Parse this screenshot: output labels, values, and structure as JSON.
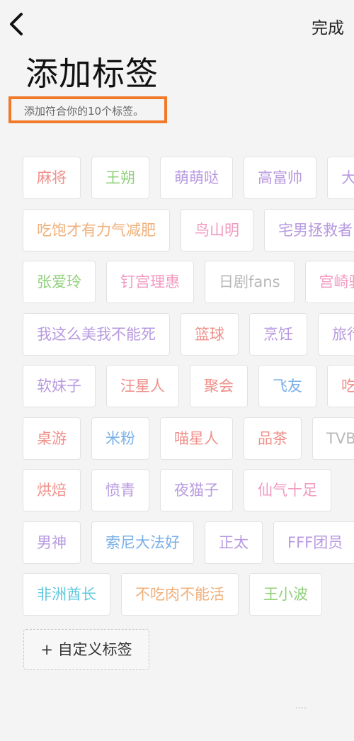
{
  "header": {
    "done_label": "完成"
  },
  "page": {
    "title": "添加标签",
    "subtitle": "添加符合你的10个标签。"
  },
  "tag_rows": [
    [
      {
        "label": "麻将",
        "color": "#f0908a"
      },
      {
        "label": "王朔",
        "color": "#8fd07a"
      },
      {
        "label": "萌萌哒",
        "color": "#b89ae0"
      },
      {
        "label": "高富帅",
        "color": "#b89ae0"
      },
      {
        "label": "大长腿",
        "color": "#b89ae0"
      }
    ],
    [
      {
        "label": "吃饱才有力气减肥",
        "color": "#f0b07a"
      },
      {
        "label": "鸟山明",
        "color": "#f29ac0"
      },
      {
        "label": "宅男拯救者",
        "color": "#b89ae0"
      }
    ],
    [
      {
        "label": "张爱玲",
        "color": "#8fd07a"
      },
      {
        "label": "钉宫理惠",
        "color": "#f29ac0"
      },
      {
        "label": "日剧fans",
        "color": "#b8b8b8"
      },
      {
        "label": "宫崎骏",
        "color": "#f29ac0"
      }
    ],
    [
      {
        "label": "我这么美我不能死",
        "color": "#b89ae0"
      },
      {
        "label": "篮球",
        "color": "#f0908a"
      },
      {
        "label": "烹饪",
        "color": "#b89ae0"
      },
      {
        "label": "旅行",
        "color": "#b89ae0"
      }
    ],
    [
      {
        "label": "软妹子",
        "color": "#b89ae0"
      },
      {
        "label": "汪星人",
        "color": "#f0908a"
      },
      {
        "label": "聚会",
        "color": "#f0908a"
      },
      {
        "label": "飞友",
        "color": "#7ab0e8"
      },
      {
        "label": "吃货",
        "color": "#f0908a"
      }
    ],
    [
      {
        "label": "桌游",
        "color": "#f0908a"
      },
      {
        "label": "米粉",
        "color": "#7ab0e8"
      },
      {
        "label": "喵星人",
        "color": "#f0908a"
      },
      {
        "label": "品茶",
        "color": "#f0908a"
      },
      {
        "label": "TVB",
        "color": "#b8b8b8"
      }
    ],
    [
      {
        "label": "烘焙",
        "color": "#f0908a"
      },
      {
        "label": "愤青",
        "color": "#b89ae0"
      },
      {
        "label": "夜猫子",
        "color": "#b89ae0"
      },
      {
        "label": "仙气十足",
        "color": "#f29ac0"
      }
    ],
    [
      {
        "label": "男神",
        "color": "#b89ae0"
      },
      {
        "label": "索尼大法好",
        "color": "#7ab0e8"
      },
      {
        "label": "正太",
        "color": "#b89ae0"
      },
      {
        "label": "FFF团员",
        "color": "#b89ae0"
      }
    ],
    [
      {
        "label": "非洲酋长",
        "color": "#5fc8e0"
      },
      {
        "label": "不吃肉不能活",
        "color": "#f0b07a"
      },
      {
        "label": "王小波",
        "color": "#8fd07a"
      }
    ]
  ],
  "custom_tag_label": "+ 自定义标签"
}
